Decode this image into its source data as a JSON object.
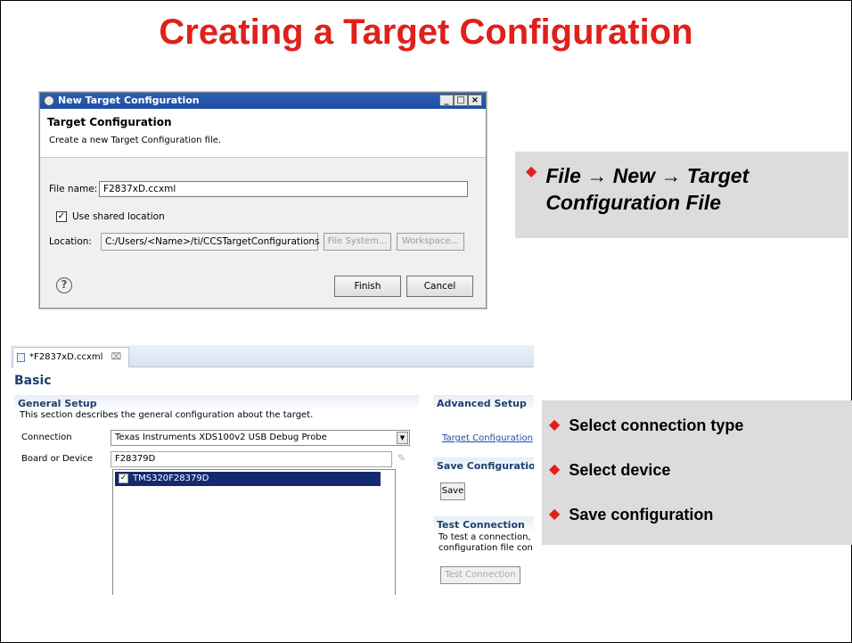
{
  "slide": {
    "title": "Creating a Target Configuration"
  },
  "dialog": {
    "window_title": "New Target Configuration",
    "window_buttons": [
      "_",
      "□",
      "×"
    ],
    "header_title": "Target Configuration",
    "header_desc": "Create a new Target Configuration file.",
    "file_name_label": "File name:",
    "file_name_value": "F2837xD.ccxml",
    "shared_label": "Use shared location",
    "shared_checked": "✓",
    "location_label": "Location:",
    "location_value": "C:/Users/<Name>/ti/CCSTargetConfigurations",
    "file_system_button": "File System...",
    "workspace_button": "Workspace...",
    "help_glyph": "?",
    "finish_button": "Finish",
    "cancel_button": "Cancel"
  },
  "callout1": {
    "bullet": "◆",
    "line1": "File → New → Target",
    "line2": "Configuration File"
  },
  "editor": {
    "tab_label": "*F2837xD.ccxml",
    "tab_close": "⌧",
    "page_title": "Basic",
    "general": {
      "title": "General Setup",
      "desc": "This section describes the general configuration about the target.",
      "connection_label": "Connection",
      "connection_value": "Texas Instruments XDS100v2 USB Debug Probe",
      "board_label": "Board or Device",
      "board_value": "F28379D",
      "device_item": "TMS320F28379D",
      "device_checked": "✓"
    },
    "advanced": {
      "title": "Advanced Setup",
      "link": "Target Configuration"
    },
    "save": {
      "title": "Save Configuration",
      "button": "Save"
    },
    "test": {
      "title": "Test Connection",
      "desc1": "To test a connection,",
      "desc2": "configuration file con",
      "button": "Test Connection"
    }
  },
  "callout2": {
    "bullet": "◆",
    "items": [
      "Select connection type",
      "Select device",
      "Save configuration"
    ]
  }
}
